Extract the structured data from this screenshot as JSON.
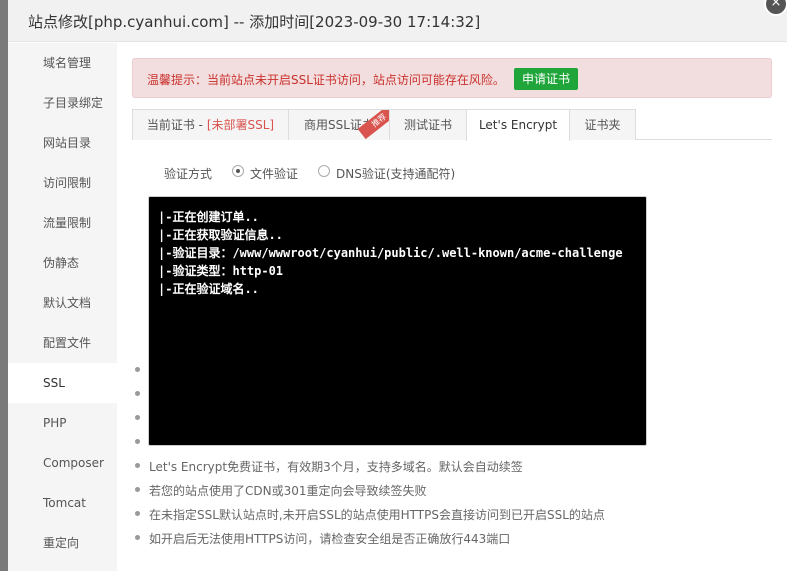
{
  "dialog": {
    "title": "站点修改[php.cyanhui.com] -- 添加时间[2023-09-30 17:14:32]",
    "close_glyph": "×"
  },
  "sidebar": {
    "items": [
      {
        "label": "域名管理"
      },
      {
        "label": "子目录绑定"
      },
      {
        "label": "网站目录"
      },
      {
        "label": "访问限制"
      },
      {
        "label": "流量限制"
      },
      {
        "label": "伪静态"
      },
      {
        "label": "默认文档"
      },
      {
        "label": "配置文件"
      },
      {
        "label": "SSL",
        "active": true
      },
      {
        "label": "PHP"
      },
      {
        "label": "Composer"
      },
      {
        "label": "Tomcat"
      },
      {
        "label": "重定向"
      }
    ]
  },
  "alert": {
    "text": "温馨提示：当前站点未开启SSL证书访问，站点访问可能存在风险。",
    "button": "申请证书"
  },
  "tabs": [
    {
      "label": "当前证书 - ",
      "status": "[未部署SSL]"
    },
    {
      "label": "商用SSL证书",
      "ribbon": "推荐"
    },
    {
      "label": "测试证书"
    },
    {
      "label": "Let's Encrypt",
      "active": true
    },
    {
      "label": "证书夹"
    }
  ],
  "verify": {
    "label": "验证方式",
    "options": [
      {
        "label": "文件验证",
        "checked": true
      },
      {
        "label": "DNS验证(支持通配符)",
        "checked": false
      }
    ]
  },
  "terminal": {
    "lines": [
      "|-正在创建订单..",
      "|-正在获取验证信息..",
      "|-验证目录：/www/wwwroot/cyanhui/public/.well-known/acme-challenge",
      "|-验证类型：http-01",
      "|-正在验证域名.."
    ]
  },
  "notes": [
    "",
    "",
    "",
    "",
    "Let's Encrypt免费证书，有效期3个月，支持多域名。默认会自动续签",
    "若您的站点使用了CDN或301重定向会导致续签失败",
    "在未指定SSL默认站点时,未开启SSL的站点使用HTTPS会直接访问到已开启SSL的站点",
    "如开启后无法使用HTTPS访问，请检查安全组是否正确放行443端口"
  ],
  "colors": {
    "accent_green": "#20a53a",
    "alert_red": "#c9302c",
    "terminal_bg": "#000000"
  }
}
